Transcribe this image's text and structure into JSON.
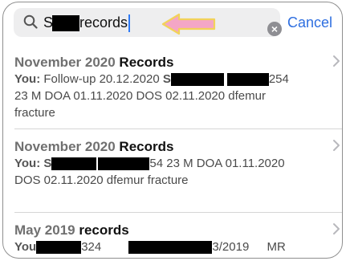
{
  "search": {
    "prefix": "S",
    "suffix": "records"
  },
  "cancel_label": "Cancel",
  "clear_symbol": "×",
  "results": [
    {
      "title_date": "November 2020",
      "title_name": "Records",
      "you_label": "You:",
      "line1_a": "Follow-up 20.12.2020",
      "line1_b": "S",
      "line1_c": "254",
      "line2": "23 M DOA 01.11.2020 DOS 02.11.2020 dfemur",
      "line3": "fracture"
    },
    {
      "title_date": "November 2020",
      "title_name": "Records",
      "you_label": "You:",
      "line1_a": "S",
      "line1_b": "54 23 M DOA 01.11.2020",
      "line2": "DOS 02.11.2020 dfemur fracture"
    },
    {
      "title_date": "May 2019",
      "title_name": "records",
      "you_label": "You",
      "line1_a": "324",
      "line1_b": "3/2019",
      "line1_c": "MR"
    }
  ],
  "icons": {
    "search": "magnifier-icon",
    "clear": "clear-circle-icon",
    "chevron": "chevron-right-icon",
    "annotation": "pink-arrow-icon"
  },
  "colors": {
    "accent": "#2f6fe0",
    "annotation_fill": "#f4a6c6",
    "annotation_stroke": "#f2d25a"
  }
}
